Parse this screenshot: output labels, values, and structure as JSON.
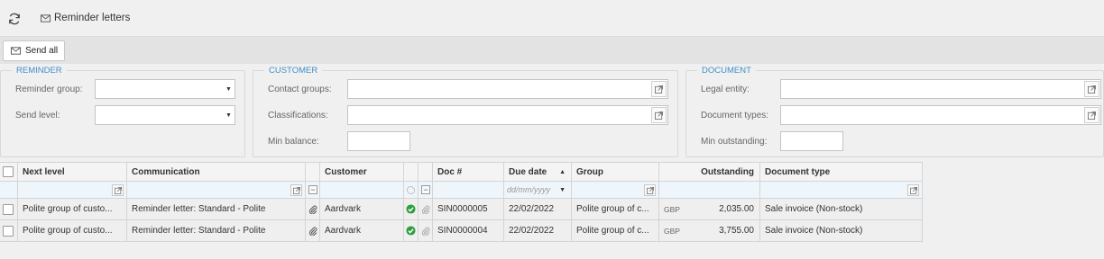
{
  "header": {
    "title": "Reminder letters",
    "icons": [
      "refresh-icon",
      "mail-icon"
    ]
  },
  "toolbar": {
    "send_all_label": "Send all"
  },
  "filters": {
    "reminder": {
      "legend": "REMINDER",
      "reminder_group_label": "Reminder group:",
      "reminder_group_value": "",
      "send_level_label": "Send level:",
      "send_level_value": ""
    },
    "customer": {
      "legend": "CUSTOMER",
      "contact_groups_label": "Contact groups:",
      "contact_groups_value": "",
      "classifications_label": "Classifications:",
      "classifications_value": "",
      "min_balance_label": "Min balance:",
      "min_balance_value": ""
    },
    "document": {
      "legend": "DOCUMENT",
      "legal_entity_label": "Legal entity:",
      "legal_entity_value": "",
      "document_types_label": "Document types:",
      "document_types_value": "",
      "min_outstanding_label": "Min outstanding:",
      "min_outstanding_value": ""
    }
  },
  "grid": {
    "columns": {
      "next_level": "Next level",
      "communication": "Communication",
      "customer": "Customer",
      "doc_no": "Doc #",
      "due_date": "Due date",
      "group": "Group",
      "outstanding": "Outstanding",
      "document_type": "Document type"
    },
    "due_date_sort": "ascending",
    "filter_row": {
      "due_date_placeholder": "dd/mm/yyyy"
    },
    "rows": [
      {
        "next_level": "Polite group of custo...",
        "communication": "Reminder letter: Standard - Polite",
        "customer": "Aardvark",
        "doc_no": "SIN0000005",
        "due_date": "22/02/2022",
        "group": "Polite group of c...",
        "currency": "GBP",
        "outstanding": "2,035.00",
        "document_type": "Sale invoice (Non-stock)"
      },
      {
        "next_level": "Polite group of custo...",
        "communication": "Reminder letter: Standard - Polite",
        "customer": "Aardvark",
        "doc_no": "SIN0000004",
        "due_date": "22/02/2022",
        "group": "Polite group of c...",
        "currency": "GBP",
        "outstanding": "3,755.00",
        "document_type": "Sale invoice (Non-stock)"
      }
    ]
  },
  "colors": {
    "legend": "#3f8ec9",
    "filter_row_bg": "#eef6fb",
    "ok_green": "#2e9e3e"
  }
}
